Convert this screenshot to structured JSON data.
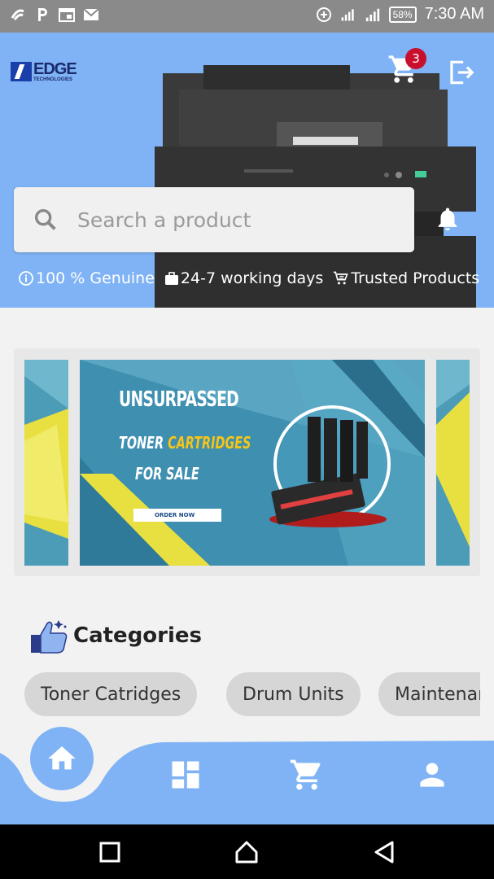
{
  "status_bar": {
    "time": "7:30 AM",
    "battery": "58%",
    "left_icons": [
      "signal-app-icon",
      "p-icon",
      "calendar-icon",
      "mail-icon"
    ]
  },
  "header": {
    "logo": {
      "name": "EDGE",
      "subtitle": "TECHNOLOGIES"
    },
    "cart_count": "3",
    "search_placeholder": "Search a product",
    "features": [
      {
        "icon": "info-icon",
        "label": "100 % Genuine"
      },
      {
        "icon": "briefcase-icon",
        "label": "24-7 working days"
      },
      {
        "icon": "cart-small-icon",
        "label": "Trusted Products"
      }
    ],
    "accent_color": "#7fb3f5"
  },
  "banner": {
    "title": "UNSURPASSED",
    "line2_a": "TONER",
    "line2_b": "CARTRIDGES",
    "line3": "FOR SALE",
    "cta": "ORDER NOW"
  },
  "categories": {
    "title": "Categories",
    "items": [
      "Toner Catridges",
      "Drum Units",
      "Maintenance"
    ]
  },
  "bottom_nav": {
    "items": [
      "home-icon",
      "dashboard-icon",
      "cart-icon",
      "profile-icon"
    ],
    "active": "home"
  },
  "android_nav": [
    "recents-icon",
    "home-icon",
    "back-icon"
  ]
}
